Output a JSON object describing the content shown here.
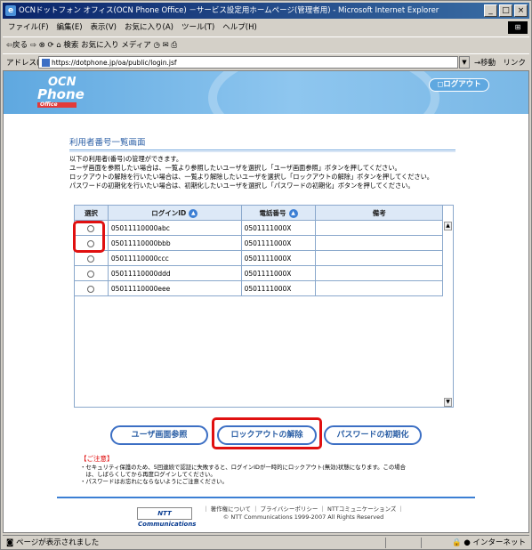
{
  "window": {
    "title": "OCNドットフォン オフィス(OCN Phone Office) －サービス設定用ホームページ(管理者用) - Microsoft Internet Explorer",
    "controls": [
      "_",
      "□",
      "×"
    ]
  },
  "menu": [
    "ファイル(F)",
    "編集(E)",
    "表示(V)",
    "お気に入り(A)",
    "ツール(T)",
    "ヘルプ(H)"
  ],
  "toolbar": {
    "back": "⇦戻る",
    "forward": "⇨",
    "search": "検索",
    "favorites": "お気に入り",
    "media": "メディア"
  },
  "address": {
    "label": "アドレス(D)",
    "url": "https://dotphone.jp/oa/public/login.jsf",
    "go": "移動",
    "links": "リンク"
  },
  "banner": {
    "logo_ocn": "OCN",
    "logo_phone": "Phone",
    "logo_office": "Office",
    "logout": "ログアウト"
  },
  "page": {
    "heading": "利用者番号一覧画面",
    "intro": [
      "以下の利用者(番号)の管理ができます。",
      "ユーザ画面を参照したい場合は、一覧より参照したいユーザを選択し「ユーザ画面参照」ボタンを押してください。",
      "ロックアウトの解除を行いたい場合は、一覧より解除したいユーザを選択し「ロックアウトの解除」ボタンを押してください。",
      "パスワードの初期化を行いたい場合は、初期化したいユーザを選択し「パスワードの初期化」ボタンを押してください。"
    ]
  },
  "table": {
    "headers": {
      "select": "選択",
      "login_id": "ログインID",
      "phone": "電話番号",
      "note": "備考"
    },
    "rows": [
      {
        "login_id": "05011110000abc",
        "phone": "0501111000X",
        "note": ""
      },
      {
        "login_id": "05011110000bbb",
        "phone": "0501111000X",
        "note": ""
      },
      {
        "login_id": "05011110000ccc",
        "phone": "0501111000X",
        "note": ""
      },
      {
        "login_id": "05011110000ddd",
        "phone": "0501111000X",
        "note": ""
      },
      {
        "login_id": "05011110000eee",
        "phone": "0501111000X",
        "note": ""
      }
    ]
  },
  "buttons": {
    "user_view": "ユーザ画面参照",
    "unlock": "ロックアウトの解除",
    "reset_password": "パスワードの初期化"
  },
  "notice": {
    "title": "【ご注意】",
    "lines": [
      "・セキュリティ保護のため、5回連続で認証に失敗すると、ログインIDが一時的にロックアウト(無効)状態になります。この場合",
      "　は、しばらくしてから再度ログインしてください。",
      "・パスワードはお忘れにならないようにご注意ください。"
    ]
  },
  "footer": {
    "ntt_logo": "NTT Communications",
    "links": "｜ 著作権について ｜ プライバシーポリシー ｜ NTTコミュニケーションズ ｜",
    "copyright": "© NTT Communications 1999-2007 All Rights Reserved"
  },
  "status": {
    "left": "ページが表示されました",
    "zone": "インターネット"
  },
  "colors": {
    "accent": "#3c6fc4",
    "highlight": "#e01010",
    "banner": "#5fa8e0"
  }
}
